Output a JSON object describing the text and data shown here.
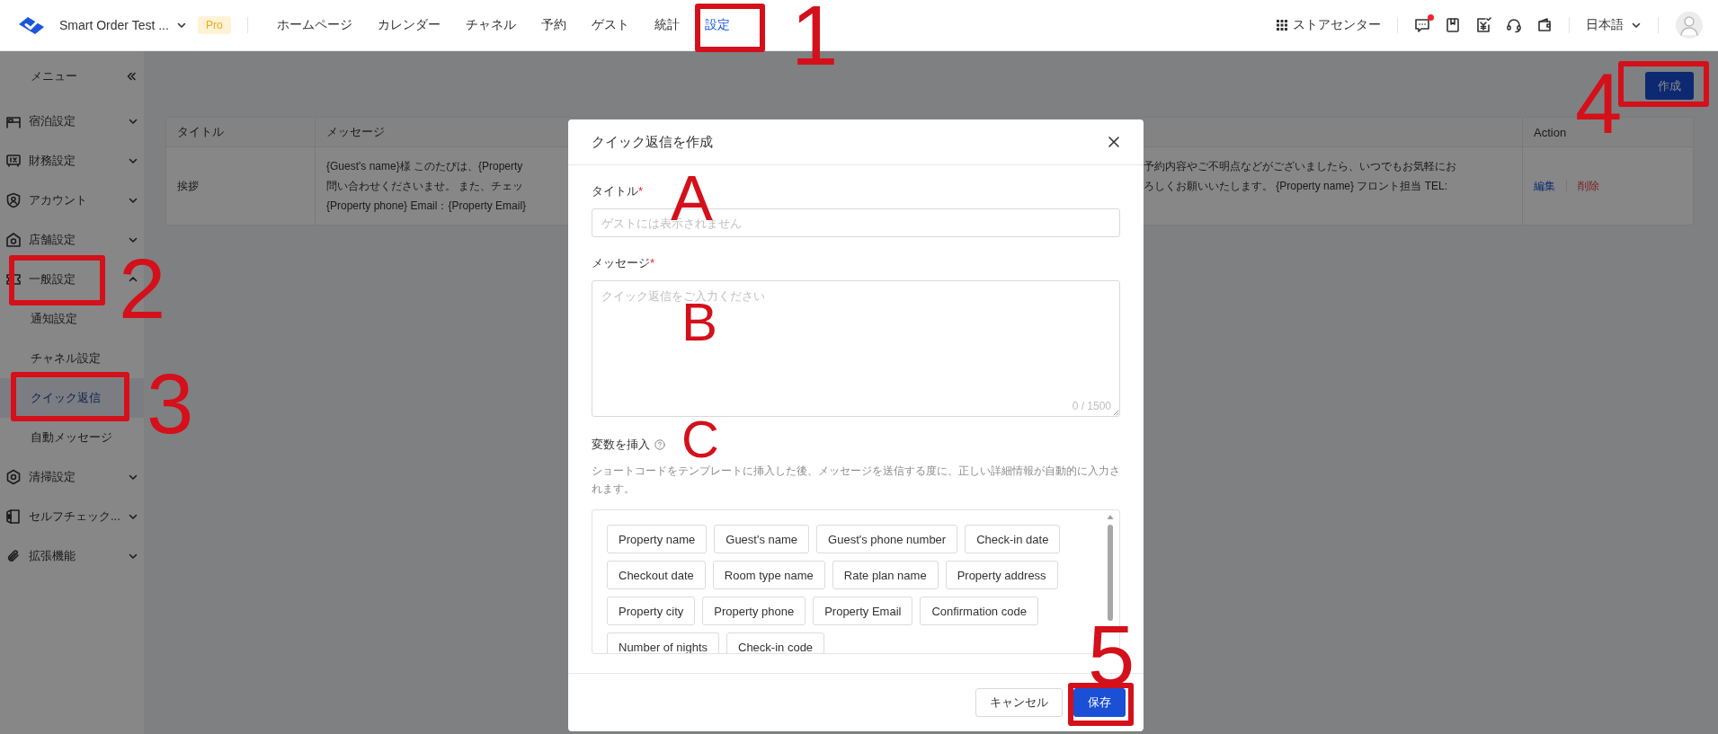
{
  "topbar": {
    "brand": "Smart Order Test ...",
    "badge": "Pro",
    "nav": [
      {
        "label": "ホームページ",
        "selected": false
      },
      {
        "label": "カレンダー",
        "selected": false
      },
      {
        "label": "チャネル",
        "selected": false
      },
      {
        "label": "予約",
        "selected": false
      },
      {
        "label": "ゲスト",
        "selected": false
      },
      {
        "label": "統計",
        "selected": false
      },
      {
        "label": "設定",
        "selected": true
      }
    ],
    "store_center": "ストアセンター",
    "messages_unread": true,
    "language": "日本語"
  },
  "sidebar": {
    "title": "メニュー",
    "items": [
      {
        "label": "宿泊設定",
        "expanded": false
      },
      {
        "label": "財務設定",
        "expanded": false
      },
      {
        "label": "アカウント",
        "expanded": false
      },
      {
        "label": "店舗設定",
        "expanded": false
      },
      {
        "label": "一般設定",
        "expanded": true,
        "children": [
          {
            "label": "通知設定",
            "selected": false
          },
          {
            "label": "チャネル設定",
            "selected": false
          },
          {
            "label": "クイック返信",
            "selected": true
          },
          {
            "label": "自動メッセージ",
            "selected": false
          }
        ]
      },
      {
        "label": "清掃設定",
        "expanded": false
      },
      {
        "label": "セルフチェック...",
        "expanded": false
      },
      {
        "label": "拡張機能",
        "expanded": false
      }
    ]
  },
  "main": {
    "create_button": "作成",
    "table": {
      "columns": [
        "タイトル",
        "メッセージ",
        "Action"
      ],
      "rows": [
        {
          "title": "挨拶",
          "message_left": [
            "{Guest's name}様 このたびは、{Property",
            "問い合わせくださいませ。 また、チェッ",
            "{Property phone} Email：{Property Email}"
          ],
          "message_right": [
            "予約内容やご不明点などがございましたら、いつでもお気軽にお",
            "ろしくお願いいたします。 {Property name} フロント担当 TEL:"
          ],
          "actions": [
            {
              "label": "編集",
              "kind": "edit"
            },
            {
              "label": "削除",
              "kind": "delete"
            }
          ]
        }
      ]
    }
  },
  "modal": {
    "title": "クイック返信を作成",
    "fields": [
      {
        "kind": "input",
        "label": "タイトル",
        "mark": "*",
        "placeholder": "ゲストには表示されません"
      },
      {
        "kind": "textarea",
        "label": "メッセージ",
        "mark": "*",
        "placeholder": "クイック返信をご入力ください",
        "counter": "0 / 1500"
      }
    ],
    "variables": {
      "label": "変数を挿入",
      "description": "ショートコードをテンプレートに挿入した後、メッセージを送信する度に、正しい詳細情報が自動的に入力されます。",
      "tags": [
        "Property name",
        "Guest's name",
        "Guest's phone number",
        "Check-in date",
        "Checkout date",
        "Room type name",
        "Rate plan name",
        "Property address",
        "Property city",
        "Property phone",
        "Property Email",
        "Confirmation code",
        "Number of nights",
        "Check-in code"
      ]
    },
    "buttons": [
      {
        "label": "キャンセル",
        "kind": "secondary"
      },
      {
        "label": "保存",
        "kind": "primary"
      }
    ]
  },
  "annotations": [
    {
      "kind": "box"
    },
    {
      "kind": "mark",
      "text": "1"
    },
    {
      "kind": "box"
    },
    {
      "kind": "mark",
      "text": "2"
    },
    {
      "kind": "box"
    },
    {
      "kind": "mark",
      "text": "3"
    },
    {
      "kind": "box"
    },
    {
      "kind": "mark",
      "text": "4"
    },
    {
      "kind": "mark",
      "text": "A"
    },
    {
      "kind": "mark",
      "text": "B"
    },
    {
      "kind": "mark",
      "text": "C"
    },
    {
      "kind": "box"
    },
    {
      "kind": "mark",
      "text": "5"
    }
  ]
}
